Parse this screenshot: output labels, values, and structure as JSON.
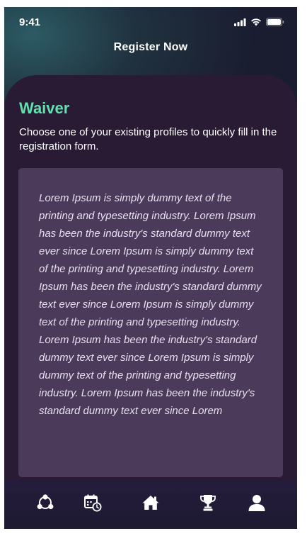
{
  "status_bar": {
    "time": "9:41"
  },
  "header": {
    "title": "Register Now"
  },
  "waiver": {
    "title": "Waiver",
    "subtitle": "Choose one of your existing profiles to quickly fill in the registration form.",
    "body": "Lorem Ipsum is simply dummy text of the printing and typesetting industry. Lorem Ipsum has been the industry's standard dummy text ever since Lorem Ipsum is simply dummy text of the printing and typesetting industry. Lorem Ipsum has been the industry's standard dummy text ever since Lorem Ipsum is simply dummy text of the printing and typesetting industry. Lorem Ipsum has been the industry's standard dummy text ever since Lorem Ipsum is simply dummy text of the printing and typesetting industry. Lorem Ipsum has been the industry's standard dummy text ever since Lorem"
  },
  "tab_bar": {
    "items": [
      {
        "icon": "community-icon"
      },
      {
        "icon": "calendar-clock-icon"
      },
      {
        "icon": "home-icon"
      },
      {
        "icon": "trophy-icon"
      },
      {
        "icon": "profile-icon"
      }
    ]
  },
  "colors": {
    "accent": "#5ee3ad",
    "card_background": "#2a1b35",
    "waiver_box": "#4c3a5a"
  }
}
